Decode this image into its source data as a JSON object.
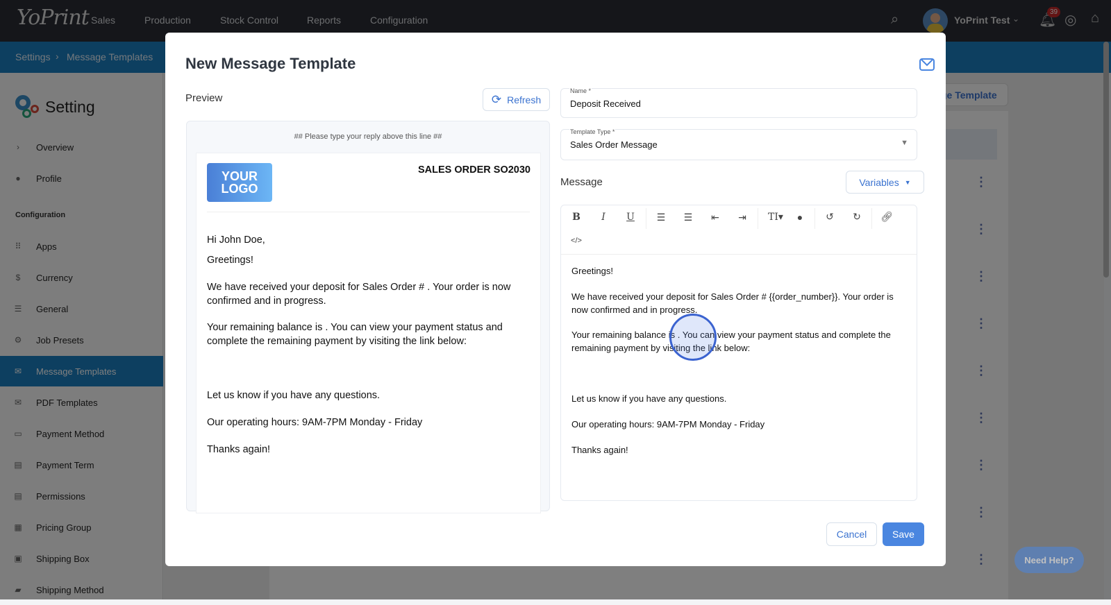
{
  "topnav": {
    "logo": "YoPrint",
    "items": [
      "Sales",
      "Production",
      "Stock Control",
      "Reports",
      "Configuration"
    ],
    "user": "YoPrint Test",
    "notifications": "39"
  },
  "breadcrumb": {
    "root": "Settings",
    "current": "Message Templates"
  },
  "sidebar": {
    "title": "Setting",
    "items": [
      {
        "label": "Overview",
        "icon": "chevron-right-icon",
        "glyph": "›"
      },
      {
        "label": "Profile",
        "icon": "person-icon",
        "glyph": "●"
      }
    ],
    "section": "Configuration",
    "config_items": [
      {
        "label": "Apps",
        "icon": "grid-icon",
        "glyph": "⠿"
      },
      {
        "label": "Currency",
        "icon": "dollar-icon",
        "glyph": "$"
      },
      {
        "label": "General",
        "icon": "sliders-icon",
        "glyph": "☰"
      },
      {
        "label": "Job Presets",
        "icon": "gear-icon",
        "glyph": "⚙"
      },
      {
        "label": "Message Templates",
        "icon": "mail-icon",
        "glyph": "✉"
      },
      {
        "label": "PDF Templates",
        "icon": "mail-icon",
        "glyph": "✉"
      },
      {
        "label": "Payment Method",
        "icon": "card-icon",
        "glyph": "▭"
      },
      {
        "label": "Payment Term",
        "icon": "clipboard-icon",
        "glyph": "▤"
      },
      {
        "label": "Permissions",
        "icon": "list-icon",
        "glyph": "▤"
      },
      {
        "label": "Pricing Group",
        "icon": "calendar-icon",
        "glyph": "▦"
      },
      {
        "label": "Shipping Box",
        "icon": "box-icon",
        "glyph": "▣"
      },
      {
        "label": "Shipping Method",
        "icon": "truck-icon",
        "glyph": "▰"
      }
    ]
  },
  "background": {
    "add_button": "ge Template",
    "need_help": "Need Help?"
  },
  "modal": {
    "title": "New Message Template",
    "preview_label": "Preview",
    "refresh": "Refresh",
    "preview": {
      "reply_line": "## Please type your reply above this line ##",
      "logo_line1": "YOUR",
      "logo_line2": "LOGO",
      "order_title": "SALES ORDER SO2030",
      "paragraphs": [
        "Hi John Doe,",
        "Greetings!",
        "We have received your deposit for Sales Order # . Your order is now confirmed and in progress.",
        "Your remaining balance is . You can view your payment status and complete the remaining payment by visiting the link below:",
        "Let us know if you have any questions.",
        "Our operating hours: 9AM-7PM Monday - Friday",
        "Thanks again!"
      ]
    },
    "name_label": "Name *",
    "name_value": "Deposit Received",
    "type_label": "Template Type *",
    "type_value": "Sales Order Message",
    "message_label": "Message",
    "variables": "Variables",
    "editor": [
      "Greetings!",
      "We have received your deposit for Sales Order # {{order_number}}. Your order is now confirmed and in progress.",
      "Your remaining balance is . You can view your payment status and complete the remaining payment by visiting the link below:",
      "Let us know if you have any questions.",
      "Our operating hours: 9AM-7PM Monday - Friday",
      "Thanks again!"
    ],
    "cancel": "Cancel",
    "save": "Save"
  },
  "colors": {
    "accent": "#3b73d0",
    "save": "#4a86e0",
    "brand_bar": "#1a7fc1"
  }
}
